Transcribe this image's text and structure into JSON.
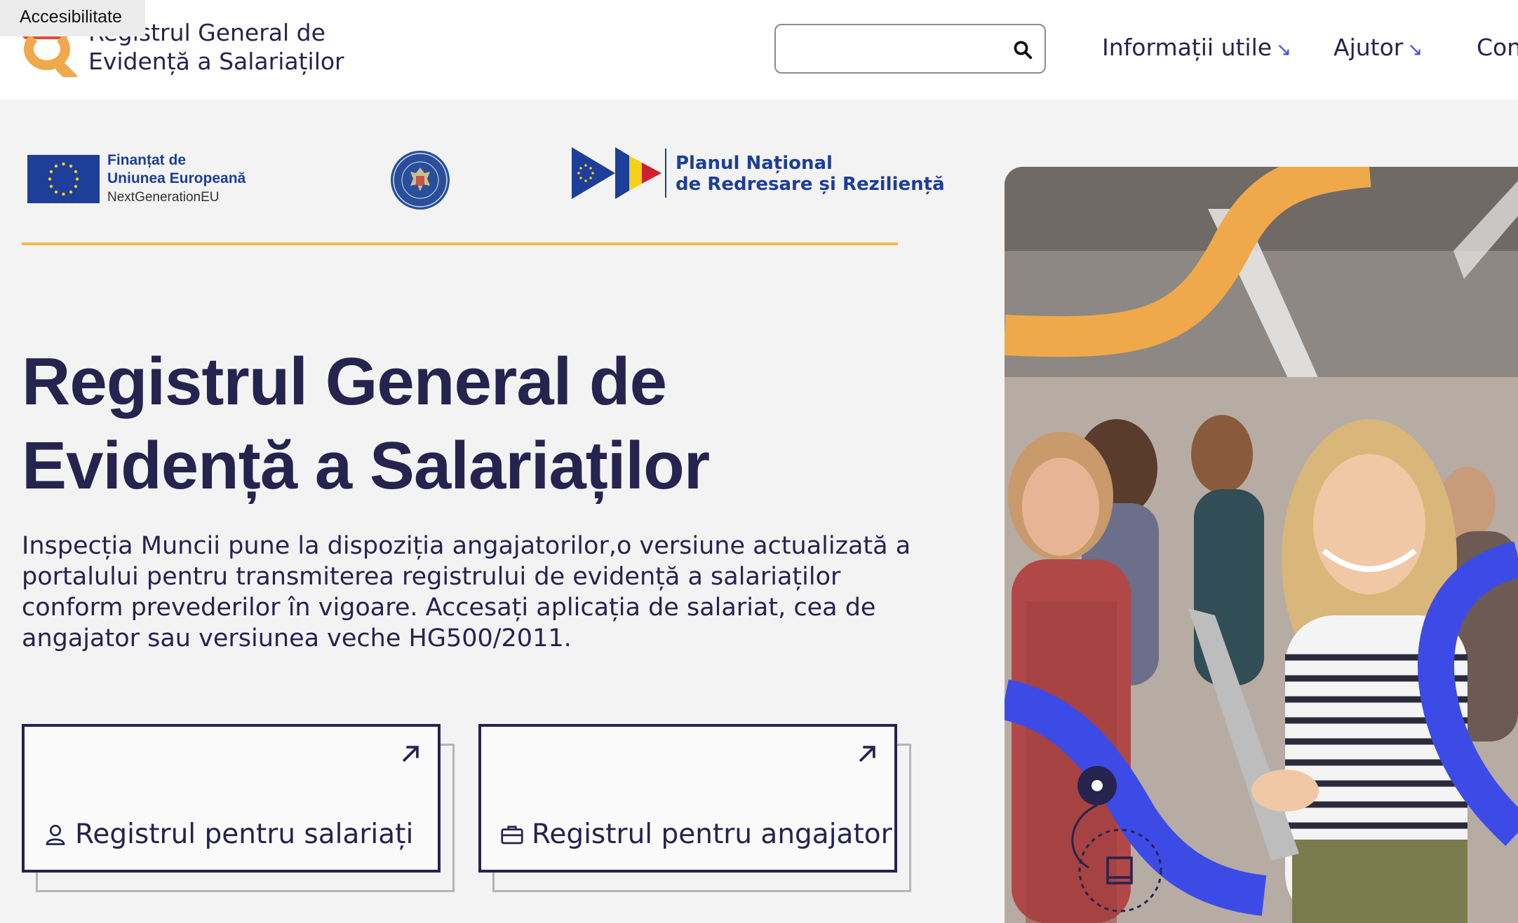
{
  "accessibility": {
    "label": "Accesibilitate"
  },
  "header": {
    "brand_line1": "Registrul General de",
    "brand_line2": "Evidență a Salariaților",
    "search": {
      "placeholder": "",
      "value": ""
    },
    "nav": [
      {
        "label": "Informații utile",
        "icon": "arrow-down-right-icon"
      },
      {
        "label": "Ajutor",
        "icon": "arrow-down-right-icon"
      },
      {
        "label": "Con"
      }
    ]
  },
  "partners": {
    "eu": {
      "line1": "Finanțat de",
      "line2": "Uniunea Europeană",
      "line3": "NextGenerationEU"
    },
    "pnrr": {
      "line1": "Planul Național",
      "line2": "de Redresare și Reziliență"
    }
  },
  "hero": {
    "title_line1": "Registrul General de",
    "title_line2": "Evidență a Salariaților",
    "description": "Inspecția Muncii pune la dispoziția angajatorilor,o versiune actualizată a portalului pentru transmiterea registrului de evidență a salariaților conform prevederilor în vigoare. Accesați aplicația de salariat, cea de angajator sau versiunea veche HG500/2011."
  },
  "cards": [
    {
      "label": "Registrul pentru salariați",
      "icon": "user-icon",
      "corner_icon": "arrow-up-right-icon"
    },
    {
      "label": "Registrul pentru angajatori",
      "icon": "briefcase-icon",
      "corner_icon": "arrow-up-right-icon"
    }
  ],
  "colors": {
    "navy": "#27234f",
    "accent_blue": "#3d4be6",
    "orange": "#f0a94a",
    "eu_blue": "#1d3e99",
    "divider": "#f2b94a"
  }
}
